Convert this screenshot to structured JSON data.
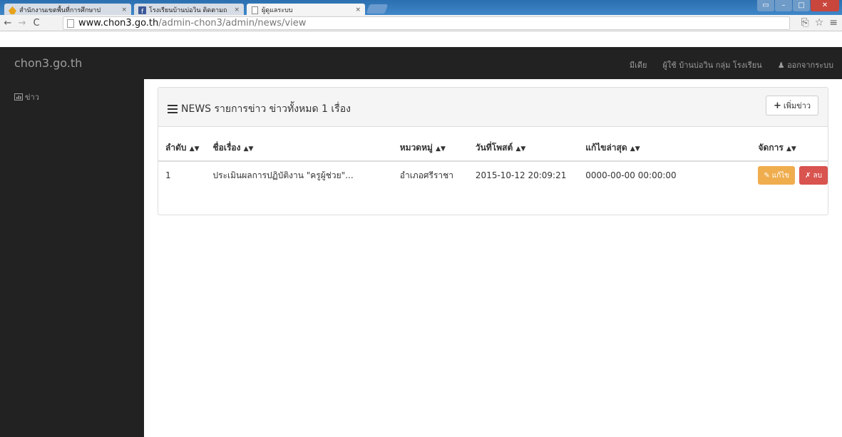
{
  "browser": {
    "tabs": [
      {
        "title": "สำนักงานเขตพื้นที่การศึกษาป",
        "active": false,
        "icon": "school-favicon"
      },
      {
        "title": "โรงเรียนบ้านบ่อวิน ติดตามถ",
        "active": false,
        "icon": "facebook-favicon"
      },
      {
        "title": "ผู้ดูแลระบบ",
        "active": true,
        "icon": "page-favicon"
      }
    ],
    "tab_close": "×",
    "url_host": "www.chon3.go.th",
    "url_path": "/admin-chon3/admin/news/view"
  },
  "navbar": {
    "brand": "chon3.go.th",
    "media": "มีเดีย",
    "user": "ผู้ใช้ บ้านบ่อวิน กลุ่ม โรงเรียน",
    "logout": "ออกจากระบบ"
  },
  "sidebar": {
    "items": [
      {
        "label": "ข่าว",
        "icon": "bar-chart-icon"
      }
    ]
  },
  "panel": {
    "title": "NEWS รายการข่าว ข่าวทั้งหมด 1 เรื่อง",
    "add_label": "เพิ่มข่าว"
  },
  "table": {
    "columns": [
      "ลำดับ",
      "ชื่อเรื่อง",
      "หมวดหมู่",
      "วันที่โพสต์",
      "แก้ไขล่าสุด",
      "จัดการ"
    ],
    "rows": [
      {
        "no": "1",
        "title": "ประเมินผลการปฏิบัติงาน \"ครูผู้ช่วย\"...",
        "category": "อำเภอศรีราชา",
        "posted": "2015-10-12 20:09:21",
        "updated": "0000-00-00 00:00:00",
        "edit_label": "แก้ไข",
        "delete_label": "ลบ"
      }
    ]
  },
  "colors": {
    "navbar": "#222222",
    "edit": "#f0ad4e",
    "delete": "#d9534f"
  }
}
